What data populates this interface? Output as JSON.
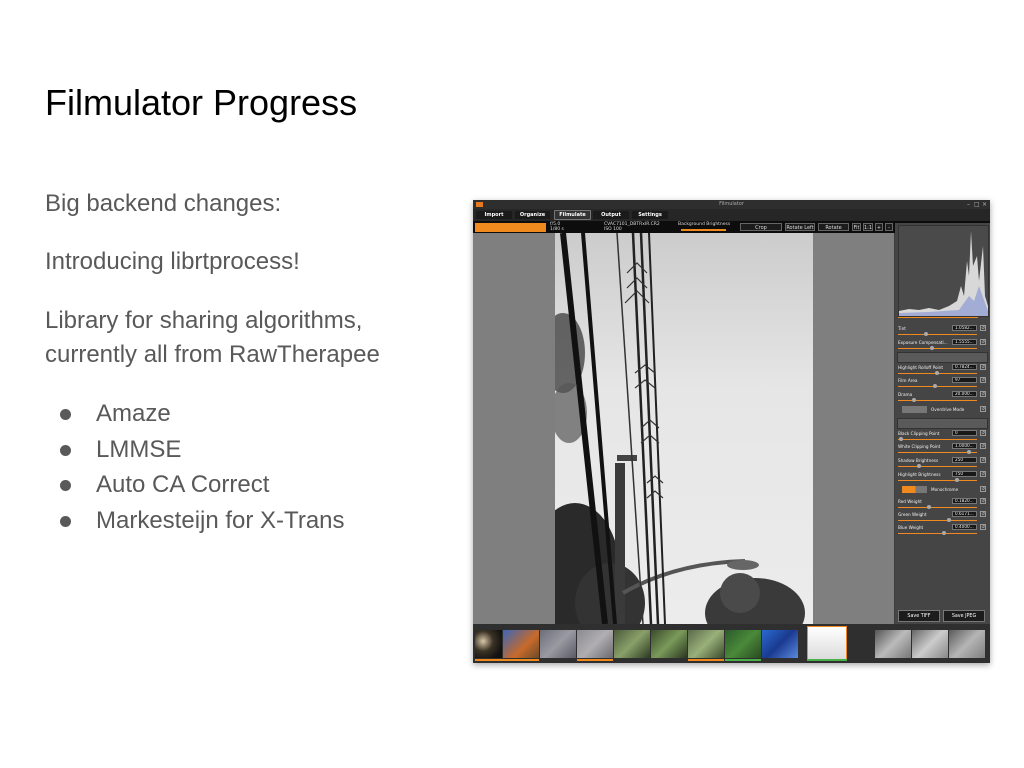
{
  "slide": {
    "title": "Filmulator Progress",
    "paragraphs": [
      "Big backend changes:",
      "Introducing librtprocess!",
      "Library for sharing algorithms,",
      "currently all from RawTherapee"
    ],
    "bullets": [
      "Amaze",
      "LMMSE",
      "Auto CA Correct",
      "Markesteijn for X-Trans"
    ]
  },
  "app": {
    "window_title": "Filmulator",
    "tabs": [
      {
        "label": "Import",
        "active": false
      },
      {
        "label": "Organize",
        "active": false
      },
      {
        "label": "Filmulate",
        "active": true
      },
      {
        "label": "Output",
        "active": false
      },
      {
        "label": "Settings",
        "active": false
      }
    ],
    "toolbar": {
      "exif_aperture_shutter": [
        "f/5.0",
        "1/80 s"
      ],
      "exif_file_iso": [
        "CVAC7101_DBTRxIR.CR2",
        "ISO 100"
      ],
      "background_brightness_label": "Background Brightness",
      "crop_label": "Crop",
      "rotate_left_label": "Rotate Left",
      "rotate_right_label": "Rotate Right",
      "fit_label": "Fit",
      "zoom_label": "1:1",
      "zoom_in_label": "+",
      "zoom_out_label": "-"
    },
    "sliders": [
      {
        "label": "Tint",
        "value": "1.0582..."
      },
      {
        "label": "Exposure Compensati...",
        "value": "1.5555..."
      },
      {
        "label": "Highlight Rolloff Point",
        "value": "0.7824..."
      },
      {
        "label": "Film Area",
        "value": "97"
      },
      {
        "label": "Drama",
        "value": "20.000..."
      },
      {
        "label": "Black Clipping Point",
        "value": "0"
      },
      {
        "label": "White Clipping Point",
        "value": "1.0000..."
      },
      {
        "label": "Shadow Brightness",
        "value": "250"
      },
      {
        "label": "Highlight Brightness",
        "value": "750"
      },
      {
        "label": "Red Weight",
        "value": "0.1820..."
      },
      {
        "label": "Green Weight",
        "value": "0.6171..."
      },
      {
        "label": "Blue Weight",
        "value": "0.4000..."
      }
    ],
    "toggles": {
      "overdrive_label": "Overdrive Mode",
      "monochrome_label": "Monochrome"
    },
    "reset_icon_label": "↺",
    "save_tiff_label": "Save TIFF",
    "save_jpeg_label": "Save JPEG",
    "accent_color": "#f08a1e",
    "filmstrip_thumbnails": [
      "dark night scene",
      "autumn tree",
      "stone texture",
      "stone texture",
      "green plants",
      "green plants",
      "green plants",
      "green foliage",
      "blue sky utility pole",
      "utility pole wires (selected)",
      "grey shadows",
      "grey shadows",
      "grey shadows"
    ]
  }
}
